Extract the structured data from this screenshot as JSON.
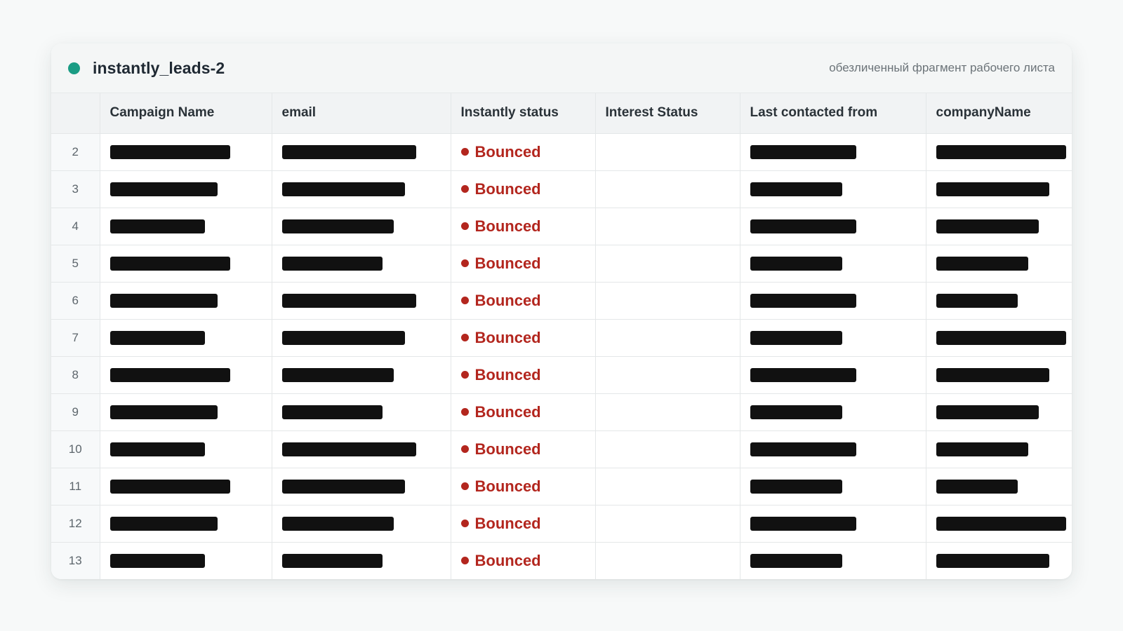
{
  "sheet": {
    "title": "instantly_leads-2",
    "subtitle": "обезличенный фрагмент рабочего листа",
    "accent_color": "#1a9c84"
  },
  "columns": [
    {
      "label": "Campaign Name"
    },
    {
      "label": "email"
    },
    {
      "label": "Instantly status"
    },
    {
      "label": "Interest Status"
    },
    {
      "label": "Last contacted from"
    },
    {
      "label": "companyName"
    }
  ],
  "status_color": "#b3261e",
  "rows": [
    {
      "num": "2",
      "status": "Bounced"
    },
    {
      "num": "3",
      "status": "Bounced"
    },
    {
      "num": "4",
      "status": "Bounced"
    },
    {
      "num": "5",
      "status": "Bounced"
    },
    {
      "num": "6",
      "status": "Bounced"
    },
    {
      "num": "7",
      "status": "Bounced"
    },
    {
      "num": "8",
      "status": "Bounced"
    },
    {
      "num": "9",
      "status": "Bounced"
    },
    {
      "num": "10",
      "status": "Bounced"
    },
    {
      "num": "11",
      "status": "Bounced"
    },
    {
      "num": "12",
      "status": "Bounced"
    },
    {
      "num": "13",
      "status": "Bounced"
    }
  ]
}
